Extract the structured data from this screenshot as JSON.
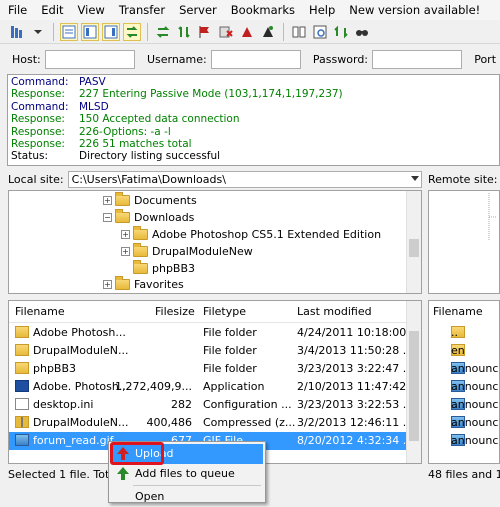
{
  "menubar": {
    "items": [
      "File",
      "Edit",
      "View",
      "Transfer",
      "Server",
      "Bookmarks",
      "Help",
      "New version available!"
    ]
  },
  "toolbar": {
    "icons": [
      "site-manager-icon",
      "dropdown-icon",
      "toggle-log-icon",
      "toggle-tree-icon",
      "toggle-remote-tree-icon",
      "toggle-queue-icon",
      "refresh-icon",
      "process-queue-icon",
      "cancel-icon",
      "disconnect-icon",
      "reconnect-icon",
      "directory-compare-icon",
      "filter-icon",
      "sync-browsing-icon",
      "search-icon"
    ]
  },
  "quickconnect": {
    "host_label": "Host:",
    "username_label": "Username:",
    "password_label": "Password:",
    "port_label": "Port"
  },
  "log": {
    "rows": [
      {
        "kind": "cmd",
        "key": "Command:",
        "text": "PASV"
      },
      {
        "kind": "resp",
        "key": "Response:",
        "text": "227 Entering Passive Mode (103,1,174,1,197,237)"
      },
      {
        "kind": "cmd",
        "key": "Command:",
        "text": "MLSD"
      },
      {
        "kind": "resp",
        "key": "Response:",
        "text": "150 Accepted data connection"
      },
      {
        "kind": "resp",
        "key": "Response:",
        "text": "226-Options: -a -l"
      },
      {
        "kind": "resp",
        "key": "Response:",
        "text": "226 51 matches total"
      },
      {
        "kind": "stat",
        "key": "Status:",
        "text": "Directory listing successful"
      }
    ]
  },
  "local_site": {
    "label": "Local site:",
    "path": "C:\\Users\\Fatima\\Downloads\\"
  },
  "remote_site": {
    "label": "Remote site:"
  },
  "local_tree": {
    "items": [
      {
        "label": "Documents"
      },
      {
        "label": "Downloads"
      },
      {
        "label": "Adobe Photoshop CS5.1 Extended Edition"
      },
      {
        "label": "DrupalModuleNew"
      },
      {
        "label": "phpBB3"
      },
      {
        "label": "Favorites"
      }
    ]
  },
  "local_list": {
    "headers": {
      "filename": "Filename",
      "filesize": "Filesize",
      "filetype": "Filetype",
      "modified": "Last modified"
    },
    "rows": [
      {
        "icon": "folder-icon",
        "name": "Adobe Photosh...",
        "size": "",
        "type": "File folder",
        "modified": "4/24/2011 10:18:00..."
      },
      {
        "icon": "folder-icon",
        "name": "DrupalModuleN...",
        "size": "",
        "type": "File folder",
        "modified": "3/4/2013 11:50:28 ..."
      },
      {
        "icon": "folder-icon",
        "name": "phpBB3",
        "size": "",
        "type": "File folder",
        "modified": "3/23/2013 3:22:47 ..."
      },
      {
        "icon": "app-icon",
        "name": "Adobe. Photosh...",
        "size": "1,272,409,9...",
        "type": "Application",
        "modified": "2/10/2013 11:47:42..."
      },
      {
        "icon": "ini-icon",
        "name": "desktop.ini",
        "size": "282",
        "type": "Configuration ...",
        "modified": "3/23/2013 3:22:53 ..."
      },
      {
        "icon": "zip-icon",
        "name": "DrupalModuleN...",
        "size": "400,486",
        "type": "Compressed (z...",
        "modified": "3/2/2013 12:46:11 ..."
      },
      {
        "icon": "image-icon",
        "name": "forum_read.gif",
        "size": "677",
        "type": "GIF File",
        "modified": "8/20/2012 4:32:34 ..."
      }
    ],
    "status": "Selected 1 file. Total"
  },
  "remote_list": {
    "header": "Filename",
    "rows": [
      {
        "icon": "folder-icon",
        "name": ".."
      },
      {
        "icon": "folder-icon",
        "name": "en"
      },
      {
        "icon": "image-icon",
        "name": "announc..."
      },
      {
        "icon": "image-icon",
        "name": "announc..."
      },
      {
        "icon": "image-icon",
        "name": "announc..."
      },
      {
        "icon": "image-icon",
        "name": "announc..."
      },
      {
        "icon": "image-icon",
        "name": "announc..."
      }
    ],
    "status": "48 files and 1"
  },
  "context_menu": {
    "items": [
      {
        "icon": "upload-arrow-icon",
        "label": "Upload"
      },
      {
        "icon": "add-queue-icon",
        "label": "Add files to queue"
      },
      {
        "icon": "",
        "label": "Open"
      }
    ]
  },
  "colors": {
    "selection": "#3399ff",
    "highlight_box": "#e0141e",
    "command": "#000080",
    "response": "#008000"
  }
}
